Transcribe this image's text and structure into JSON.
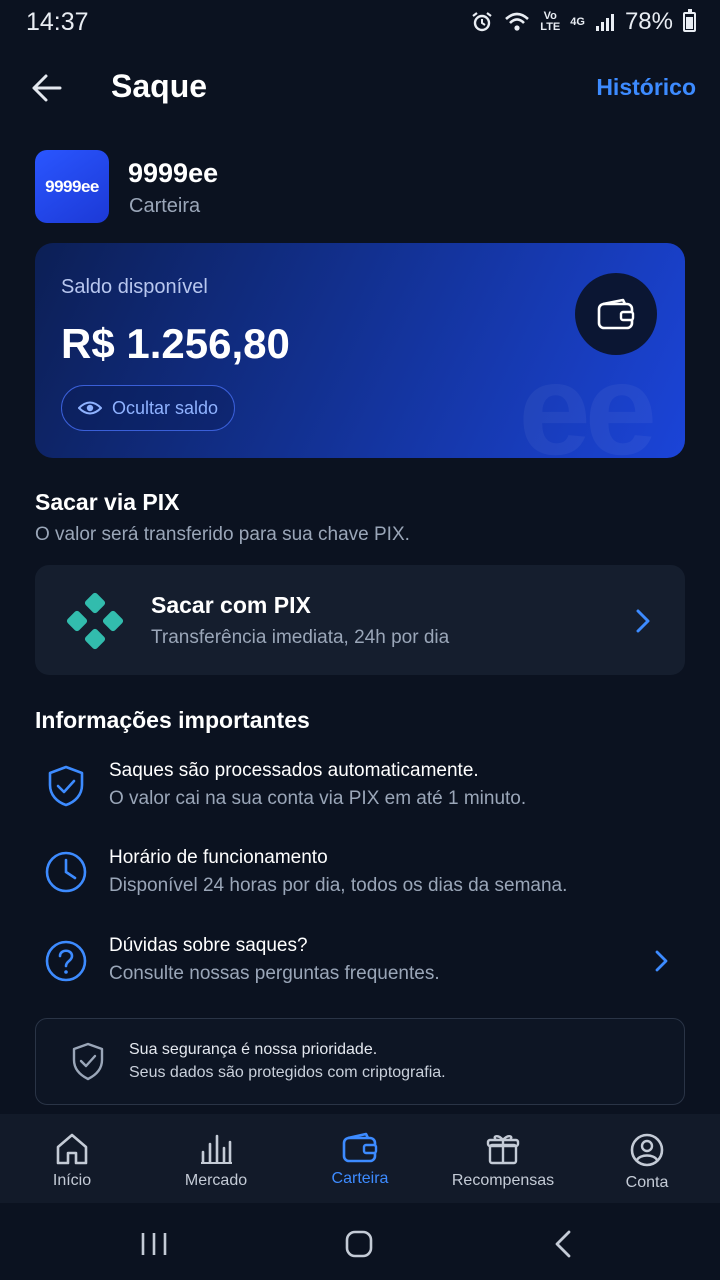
{
  "status_bar": {
    "time": "14:37",
    "battery": "78%",
    "network": "4G",
    "volte_top": "Vo",
    "volte_bottom": "LTE",
    "battery_level": 0.78
  },
  "header": {
    "title": "Saque",
    "history_label": "Histórico"
  },
  "wallet": {
    "logo_text": "9999ee",
    "name": "9999ee",
    "subtitle": "Carteira"
  },
  "balance": {
    "label": "Saldo disponível",
    "value": "R$ 1.256,80",
    "hide_label": "Ocultar saldo",
    "watermark": "ee"
  },
  "pix_section": {
    "title": "Sacar via PIX",
    "subtitle": "O valor será transferido para sua chave PIX.",
    "option_title": "Sacar com PIX",
    "option_subtitle": "Transferência imediata, 24h por dia"
  },
  "info": {
    "title": "Informações importantes",
    "items": [
      {
        "icon": "shield-check-icon",
        "title": "Saques são processados automaticamente.",
        "subtitle": "O valor cai na sua conta via PIX em até 1 minuto."
      },
      {
        "icon": "clock-icon",
        "title": "Horário de funcionamento",
        "subtitle": "Disponível 24 horas por dia, todos os dias da semana."
      },
      {
        "icon": "question-icon",
        "title": "Dúvidas sobre saques?",
        "subtitle": "Consulte nossas perguntas frequentes."
      }
    ]
  },
  "security": {
    "title": "Sua segurança é nossa prioridade.",
    "subtitle": "Seus dados são protegidos com criptografia."
  },
  "bottom_nav": {
    "items": [
      {
        "label": "Início",
        "icon": "home-icon"
      },
      {
        "label": "Mercado",
        "icon": "chart-icon"
      },
      {
        "label": "Carteira",
        "icon": "wallet-icon"
      },
      {
        "label": "Recompensas",
        "icon": "gift-icon"
      },
      {
        "label": "Conta",
        "icon": "user-icon"
      }
    ],
    "active": "Carteira"
  },
  "colors": {
    "background": "#0b1220",
    "accent": "#3d8bff",
    "pix": "#32bcad",
    "card": "#151e2e"
  }
}
